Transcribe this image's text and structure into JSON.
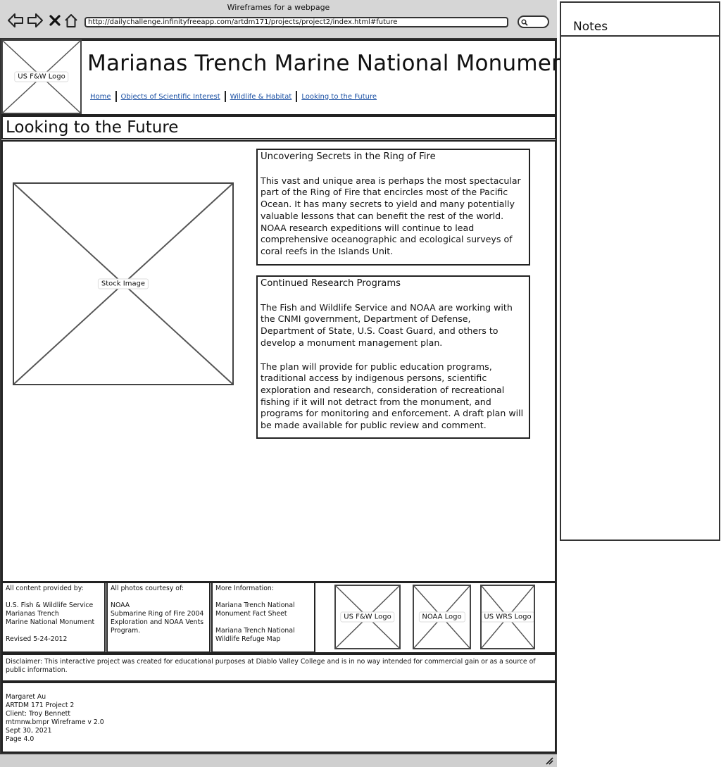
{
  "window": {
    "title": "Wireframes for a webpage",
    "url": "http://dailychallenge.infinityfreeapp.com/artdm171/projects/project2/index.html#future"
  },
  "icons": [
    "back-arrow-icon",
    "forward-arrow-icon",
    "close-x-icon",
    "home-icon",
    "search-icon",
    "resize-grip-icon"
  ],
  "header": {
    "logo_label": "US F&W Logo",
    "site_title": "Marianas Trench Marine National Monument",
    "nav": [
      {
        "label": "Home"
      },
      {
        "label": "Objects of Scientific Interest"
      },
      {
        "label": "Wildlife & Habitat"
      },
      {
        "label": "Looking to the Future"
      }
    ]
  },
  "page_heading": "Looking to the Future",
  "main": {
    "image_label": "Stock Image",
    "cards": [
      {
        "title": "Uncovering Secrets in the Ring of Fire",
        "paragraphs": [
          "This vast and unique area is perhaps the most spectacular part of the Ring of Fire that encircles most of the Pacific Ocean. It has many secrets to yield and many potentially valuable lessons that can benefit the rest of the world. NOAA research expeditions will continue to lead comprehensive oceanographic and ecological surveys of coral reefs in the Islands Unit."
        ]
      },
      {
        "title": "Continued Research Programs",
        "paragraphs": [
          "The Fish and Wildlife Service and NOAA are working with the CNMI government, Department of Defense, Department of State, U.S. Coast Guard, and others to develop a monument management plan.",
          "The plan will provide for public education programs, traditional access by indigenous persons, scientific exploration and research, consideration of recreational fishing if it will not detract from the monument, and programs for monitoring and enforcement. A draft plan will be made available for public review and comment."
        ]
      }
    ]
  },
  "footer": {
    "credits": {
      "heading": "All content provided by:",
      "lines": [
        "U.S. Fish & Wildlife Service",
        "Marianas Trench",
        "Marine National Monument"
      ],
      "revised": "Revised 5-24-2012"
    },
    "photos": {
      "heading": "All photos courtesy of:",
      "lines": [
        "NOAA",
        "Submarine Ring of Fire 2004 Exploration and NOAA Vents Program."
      ]
    },
    "more": {
      "heading": "More Information:",
      "link1": "Mariana Trench National Monument Fact Sheet",
      "link2": "Mariana Trench National Wildlife Refuge Map"
    },
    "logos": [
      "US F&W Logo",
      "NOAA Logo",
      "US WRS Logo"
    ],
    "disclaimer": "Disclaimer: This interactive project was created for educational purposes at Diablo Valley College and is in no way intended for commercial gain or as a source of public information.",
    "author_lines": [
      "Margaret Au",
      "ARTDM 171 Project 2",
      "Client: Troy Bennett",
      "mtmnw.bmpr Wireframe v 2.0",
      "Sept 30, 2021",
      "Page 4.0"
    ]
  },
  "notes": {
    "title": "Notes"
  }
}
